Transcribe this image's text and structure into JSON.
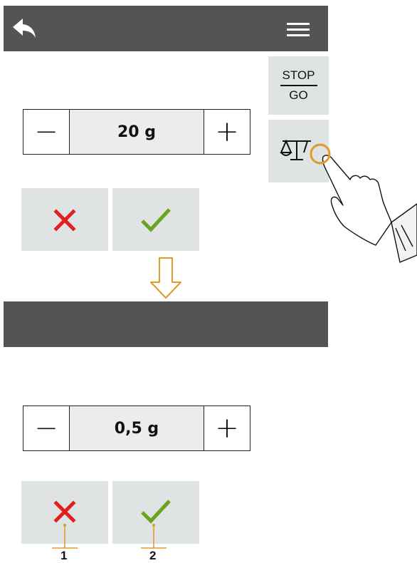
{
  "screen_top": {
    "icons": {
      "back": "back-arrow-icon",
      "menu": "hamburger-menu-icon"
    },
    "side_buttons": {
      "stop_label": "STOP",
      "go_label": "GO",
      "scale_icon": "scale-tare-icon"
    },
    "stepper": {
      "minus": "−",
      "value": "20 g",
      "plus": "+"
    },
    "actions": {
      "cancel_icon": "cross-icon",
      "confirm_icon": "check-icon"
    }
  },
  "transition": {
    "icon": "down-arrow-icon"
  },
  "screen_bottom": {
    "stepper": {
      "minus": "−",
      "value": "0,5 g",
      "plus": "+"
    },
    "actions": {
      "cancel_icon": "cross-icon",
      "confirm_icon": "check-icon"
    },
    "callouts": [
      "1",
      "2"
    ]
  },
  "colors": {
    "header_bar": "#545454",
    "tile": "#dfe3e3",
    "cancel": "#e01f1f",
    "confirm": "#6aa31e",
    "highlight": "#e09a2a"
  }
}
